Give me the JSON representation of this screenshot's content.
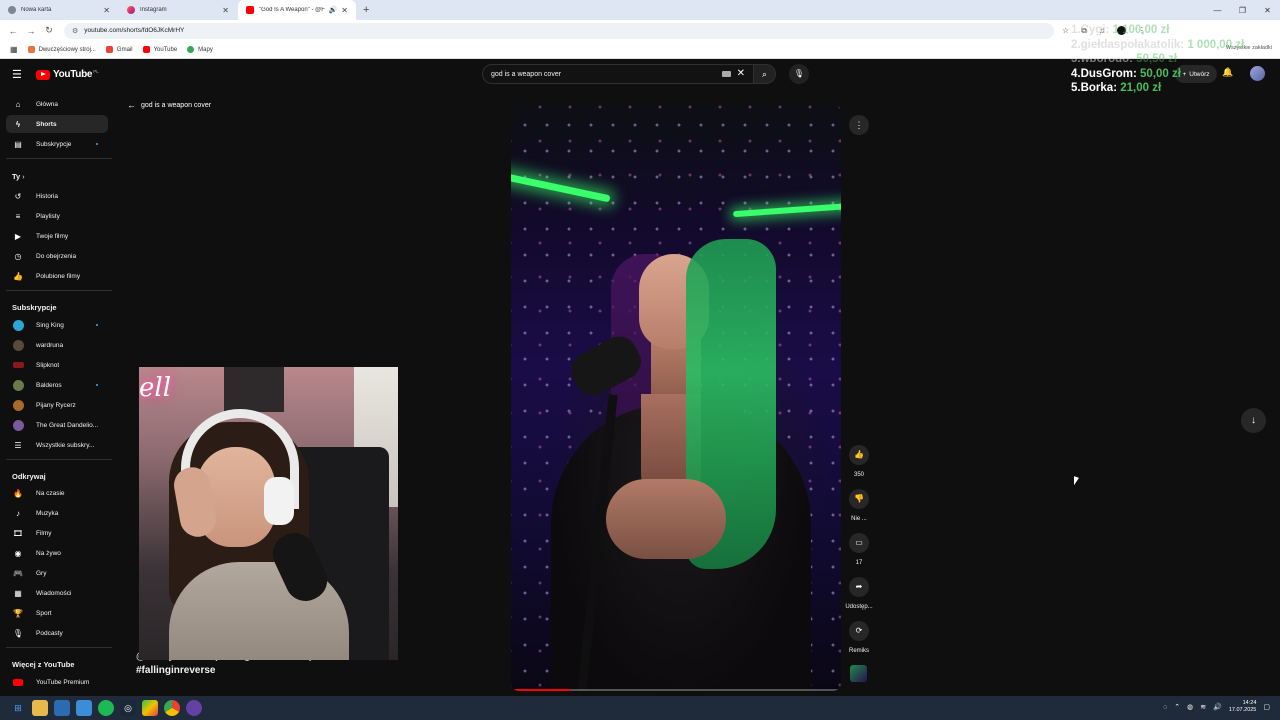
{
  "browser": {
    "tabs": [
      {
        "title": "Nowa karta",
        "icon": "chrome-icon",
        "active": false
      },
      {
        "title": "Instagram",
        "icon": "instagram-icon",
        "active": false
      },
      {
        "title": "\"God Is A Weapon\" - @Fall",
        "icon": "youtube-icon",
        "active": true
      }
    ],
    "url": "youtube.com/shorts/fdO6JKcMrHY",
    "bookmarks": [
      {
        "label": "Dwuczęściowy stroj...",
        "color": "#e8743b"
      },
      {
        "label": "Gmail",
        "color": "#ea4335"
      },
      {
        "label": "YouTube",
        "color": "#ff0000"
      },
      {
        "label": "Mapy",
        "color": "#34a853"
      }
    ],
    "bookmarks_right": "Wszystkie zakładki"
  },
  "youtube": {
    "logo": "YouTube",
    "country": "PL",
    "search_value": "god is a weapon cover",
    "create_label": "Utwórz",
    "back_label": "god is a weapon cover",
    "sidebar": {
      "main": [
        {
          "label": "Główna",
          "icon": "home-icon"
        },
        {
          "label": "Shorts",
          "icon": "shorts-icon",
          "active": true
        },
        {
          "label": "Subskrypcje",
          "icon": "subscriptions-icon",
          "dot": true
        }
      ],
      "you_heading": "Ty",
      "you": [
        {
          "label": "Historia",
          "icon": "history-icon"
        },
        {
          "label": "Playlisty",
          "icon": "playlist-icon"
        },
        {
          "label": "Twoje filmy",
          "icon": "your-videos-icon"
        },
        {
          "label": "Do obejrzenia",
          "icon": "watch-later-icon"
        },
        {
          "label": "Polubione filmy",
          "icon": "like-icon"
        }
      ],
      "subs_heading": "Subskrypcje",
      "subs": [
        {
          "label": "Sing King",
          "color": "#2aa7d6",
          "dot": true
        },
        {
          "label": "wardruna",
          "color": "#5a4a3a"
        },
        {
          "label": "Slipknot",
          "color": "#8a1a1a"
        },
        {
          "label": "Balderos",
          "color": "#6b7a4a",
          "dot": true
        },
        {
          "label": "Pijany Rycerz",
          "color": "#a86a2a"
        },
        {
          "label": "The Great Dandelio...",
          "color": "#7a5a9a"
        },
        {
          "label": "Wszystkie subskry...",
          "color": "#272727"
        }
      ],
      "explore_heading": "Odkrywaj",
      "explore": [
        {
          "label": "Na czasie",
          "icon": "trending-icon"
        },
        {
          "label": "Muzyka",
          "icon": "music-icon"
        },
        {
          "label": "Filmy",
          "icon": "movies-icon"
        },
        {
          "label": "Na żywo",
          "icon": "live-icon"
        },
        {
          "label": "Gry",
          "icon": "gaming-icon"
        },
        {
          "label": "Wiadomości",
          "icon": "news-icon"
        },
        {
          "label": "Sport",
          "icon": "sport-icon"
        },
        {
          "label": "Podcasty",
          "icon": "podcast-icon"
        }
      ],
      "more_heading": "Więcej z YouTube",
      "more": [
        {
          "label": "YouTube Premium",
          "icon": "youtube-premium-icon"
        }
      ]
    },
    "actions": {
      "likes": "350",
      "dislike": "Nie ...",
      "comments": "17",
      "share": "Udostęp...",
      "remix": "Remiks"
    },
    "caption_line1": "@mikeymcallen (reimagined version)",
    "caption_line2": "#fallinginreverse",
    "progress": 0.18
  },
  "donations": [
    {
      "rank": "1.",
      "name": "Cygi:",
      "amount": "1 100,00 zł",
      "style": "faded"
    },
    {
      "rank": "2.",
      "name": "giełdaspołakatolik:",
      "amount": "1 000,00 zł",
      "style": "faded"
    },
    {
      "rank": "3.",
      "name": "wborodo:",
      "amount": "50,50 zł",
      "style": "dark-faded"
    },
    {
      "rank": "4.",
      "name": "DusGrom:",
      "amount": "50,00 zł",
      "style": "dark"
    },
    {
      "rank": "5.",
      "name": "Borka:",
      "amount": "21,00 zł",
      "style": "dark"
    }
  ],
  "taskbar": {
    "time": "14:24",
    "date": "17.07.2025"
  }
}
